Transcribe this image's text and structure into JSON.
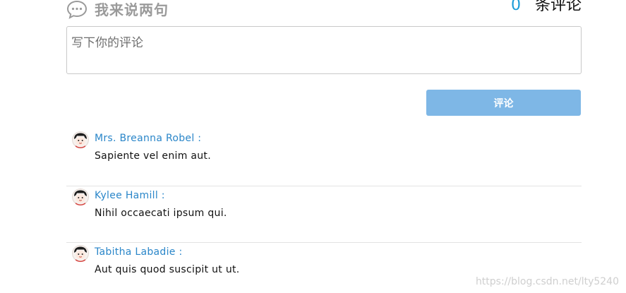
{
  "header": {
    "icon": "chat-bubble-icon",
    "title": "我来说两句",
    "count": "0",
    "count_label": "条评论"
  },
  "form": {
    "placeholder": "写下你的评论",
    "submit_label": "评论"
  },
  "comments": [
    {
      "author": "Mrs. Breanna Robel :",
      "text": "Sapiente vel enim aut.",
      "avatar_icon": "avatar-icon"
    },
    {
      "author": "Kylee Hamill :",
      "text": "Nihil occaecati ipsum qui.",
      "avatar_icon": "avatar-icon"
    },
    {
      "author": "Tabitha Labadie :",
      "text": "Aut quis quod suscipit ut ut.",
      "avatar_icon": "avatar-icon"
    }
  ],
  "watermark": "https://blog.csdn.net/lty5240",
  "colors": {
    "accent": "#1a9bd7",
    "button": "#7eb7e6",
    "author": "#2a86c9"
  }
}
